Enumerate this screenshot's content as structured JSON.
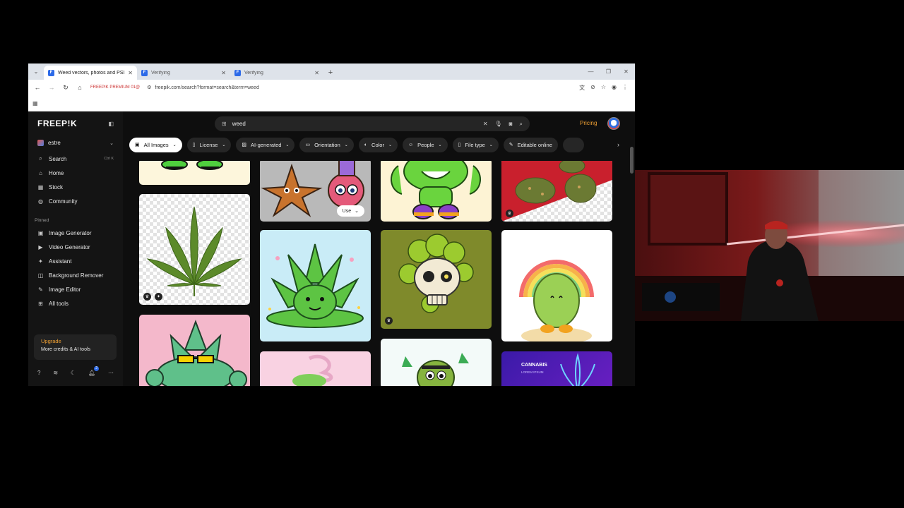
{
  "browser": {
    "tabs": [
      {
        "label": "Weed vectors, photos and PSD",
        "active": true
      },
      {
        "label": "Verifying",
        "active": false
      },
      {
        "label": "Verifying",
        "active": false
      }
    ],
    "extension_tag": "FREEPIK PREMIUM 01@",
    "url": "freepik.com/search?format=search&term=weed"
  },
  "sidebar": {
    "logo": "FREEP!K",
    "workspace": "estre",
    "nav": [
      {
        "label": "Search",
        "shortcut": "Ctrl K",
        "icon": "search-icon"
      },
      {
        "label": "Home",
        "icon": "home-icon"
      },
      {
        "label": "Stock",
        "icon": "stock-icon"
      },
      {
        "label": "Community",
        "icon": "community-icon"
      }
    ],
    "pinned_title": "Pinned",
    "pinned": [
      {
        "label": "Image Generator",
        "icon": "image-generator-icon"
      },
      {
        "label": "Video Generator",
        "icon": "video-generator-icon"
      },
      {
        "label": "Assistant",
        "icon": "assistant-icon"
      },
      {
        "label": "Background Remover",
        "icon": "background-remover-icon"
      },
      {
        "label": "Image Editor",
        "icon": "image-editor-icon"
      },
      {
        "label": "All tools",
        "icon": "all-tools-icon"
      }
    ],
    "upgrade_title": "Upgrade",
    "upgrade_sub": "More credits & AI tools",
    "notification_count": "2"
  },
  "search": {
    "query": "weed"
  },
  "header": {
    "pricing": "Pricing"
  },
  "filters": [
    {
      "label": "All Images",
      "active": true
    },
    {
      "label": "License"
    },
    {
      "label": "AI-generated"
    },
    {
      "label": "Orientation"
    },
    {
      "label": "Color"
    },
    {
      "label": "People"
    },
    {
      "label": "File type"
    },
    {
      "label": "Editable online"
    }
  ],
  "results": {
    "use_button": "Use",
    "banner_text": "CANNABIS",
    "banner_sub": "LOREM IPSUM"
  },
  "colors": {
    "accent_orange": "#f0a033",
    "weed_green": "#5dc443",
    "bg_dark": "#0e0e0e"
  }
}
